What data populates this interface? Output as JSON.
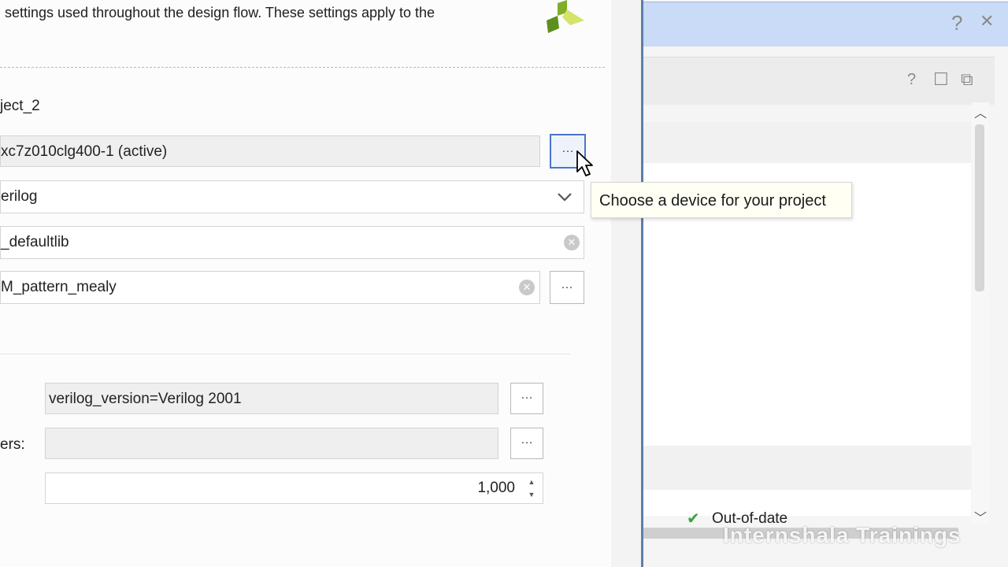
{
  "description_text": "settings used throughout the design flow. These settings apply to the",
  "project": {
    "name_value": "ject_2",
    "device_value": "xc7z010clg400-1 (active)",
    "language_value": "erilog",
    "library_value": "_defaultlib",
    "top_module_value": "M_pattern_mealy"
  },
  "buttons": {
    "more_label": "···"
  },
  "lower": {
    "verilog_options_value": "verilog_version=Verilog 2001",
    "generics_label": "ers:",
    "generics_value": "",
    "loop_count_value": "1,000"
  },
  "tooltip_text": "Choose a device for your project",
  "right_panel": {
    "help_icon": "?",
    "close_icon": "✕",
    "sub_help_icon": "?",
    "maximize_icon": "☐",
    "float_icon": "⧉",
    "status_text": "Out-of-date"
  },
  "watermark_text": "Internshala Trainings"
}
